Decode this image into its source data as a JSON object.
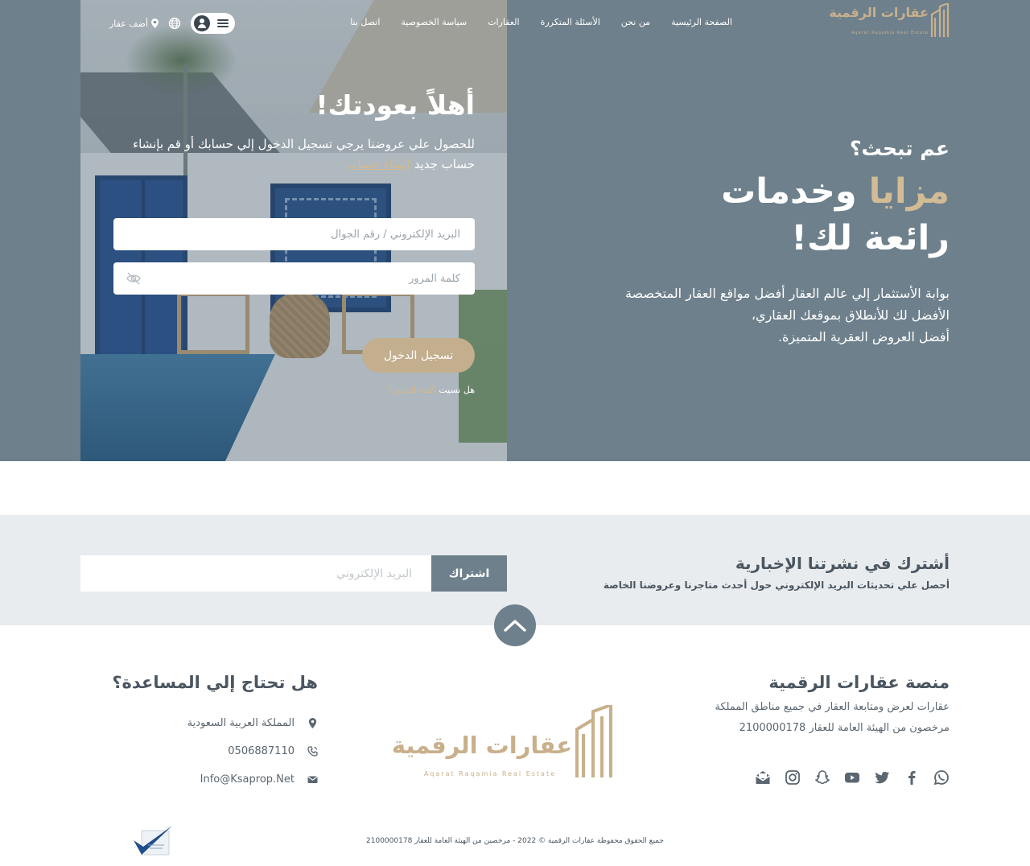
{
  "header": {
    "logo_text": "عقارات الرقمية",
    "logo_sub": "Aqarat Raqamia Real Estate",
    "menu": [
      "الصفحة الرئيسية",
      "من نحن",
      "الأسئلة المتكررة",
      "العقارات",
      "سياسة الخصوصية",
      "اتصل بنا"
    ],
    "add_property": "أضف عقار"
  },
  "login": {
    "title": "أهلاً بعودتك!",
    "lead": "للحصول علي عروضنا يرجي تسجيل الدخول إلي حسابك أو قم بإنشاء حساب جديد",
    "create_account": "إنشاء حساب",
    "email_placeholder": "البريد الإلكتروني / رقم الجوال",
    "password_placeholder": "كلمة المرور",
    "submit": "تسجيل الدخول",
    "forgot_prefix": "هل نسيت",
    "forgot_link": "كلمة المرور؟"
  },
  "hero": {
    "question": "عم تبحث؟",
    "headline_accent": "مزايا",
    "headline_rest": "وخدمات",
    "headline_line2": "رائعة لك!",
    "desc_lines": [
      "بوابة الأستثمار إلي عالم العقار أفضل مواقع العقار المتخصصة",
      "الأفضل لك للأنطلاق بموقعك العقاري،",
      "أفضل العروض العقرية المتميزة."
    ]
  },
  "newsletter": {
    "title": "أشترك في نشرتنا الإخبارية",
    "subtitle": "أحصل علي تحديثات البريد الإلكتروني حول أحدث متاجرنا وعروضنا الخاصة",
    "email_placeholder": "البريد الإلكتروني",
    "subscribe": "اشتراك"
  },
  "footer": {
    "about_title": "منصة عقارات الرقمية",
    "about_line1": "عقارات لعرض ومتابعة العقار في جميع مناطق المملكة",
    "about_line2": "مرخصون من الهيئة العامة للعقار 2100000178",
    "socials": [
      "whatsapp-icon",
      "facebook-icon",
      "twitter-icon",
      "youtube-icon",
      "snapchat-icon",
      "instagram-icon",
      "email-open-icon"
    ],
    "logo_text": "عقارات الرقمية",
    "logo_sub": "Aqarat Raqamia Real Estate",
    "help_title": "هل تحتاج إلي المساعدة؟",
    "address": "المملكة العربية السعودية",
    "phone": "0506887110",
    "email": "Info@Ksaprop.Net",
    "copyright": "جميع الحقوق محفوظة عقارات الرقمية © 2022 - مرخصين من الهيئة العامة للعقار 2100000178"
  },
  "colors": {
    "hero_bg": "#6e808c",
    "accent_gold": "#c3ae8d",
    "newsletter_bg": "#e9ecee",
    "text_dark": "#4a5661"
  }
}
